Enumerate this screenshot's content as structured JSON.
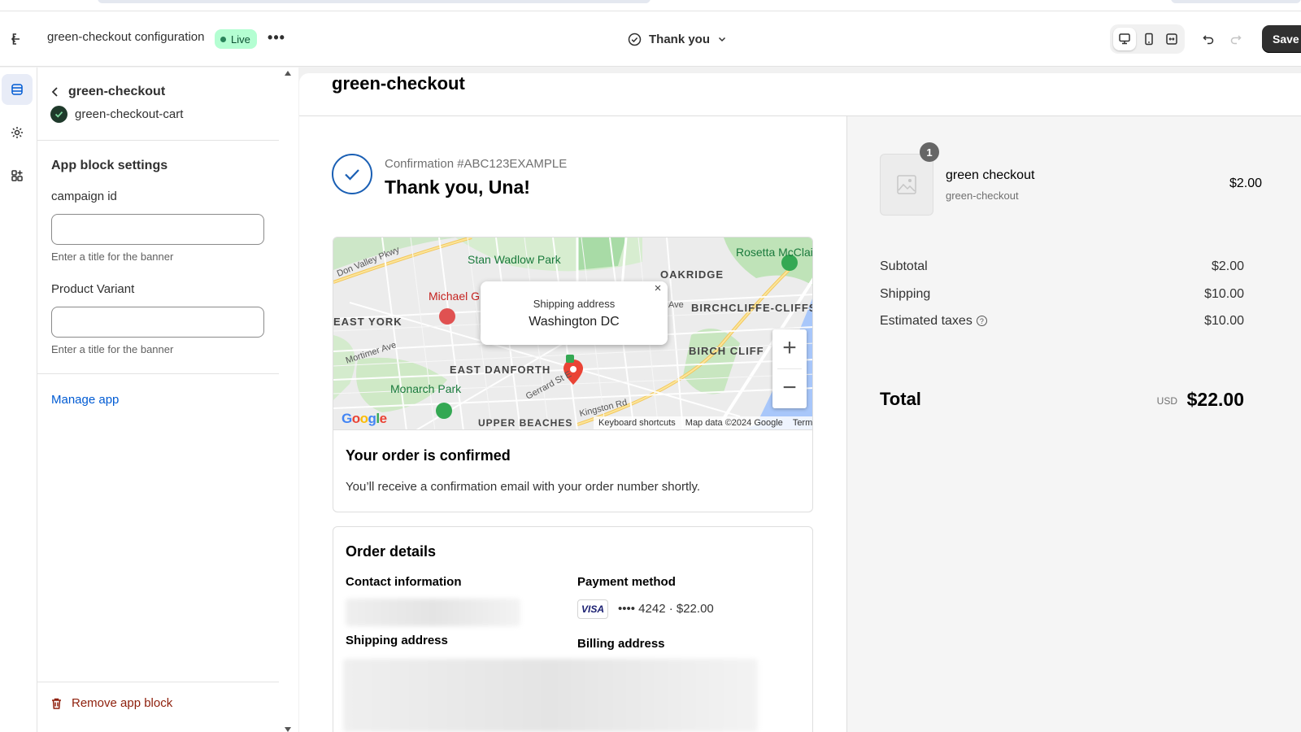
{
  "header": {
    "title": "green-checkout configuration",
    "status": "Live",
    "page_selector": "Thank you",
    "save_label": "Save"
  },
  "panel": {
    "back_title": "green-checkout",
    "app_name": "green-checkout-cart",
    "section_title": "App block settings",
    "fields": [
      {
        "label": "campaign id",
        "value": "",
        "help": "Enter a title for the banner"
      },
      {
        "label": "Product Variant",
        "value": "",
        "help": "Enter a title for the banner"
      }
    ],
    "manage_link": "Manage app",
    "remove_label": "Remove app block"
  },
  "preview": {
    "shop_name": "green-checkout",
    "confirmation_number": "Confirmation #ABC123EXAMPLE",
    "thank_you": "Thank you, Una!",
    "map": {
      "popup_title": "Shipping address",
      "popup_value": "Washington DC",
      "popup_close": "×",
      "zoom_in": "+",
      "zoom_out": "−",
      "logo": "Google",
      "attribution": [
        "Keyboard shortcuts",
        "Map data ©2024 Google",
        "Terms"
      ],
      "neighborhoods": [
        "OAKRIDGE",
        "BIRCHCLIFFE-CLIFFSI",
        "EAST YORK",
        "BIRCH CLIFF",
        "EAST DANFORTH",
        "UPPER BEACHES"
      ],
      "parks": [
        "Stan Wadlow Park",
        "Rosetta McClain Gardens",
        "Monarch Park",
        "Michael G"
      ],
      "streets": [
        "Don Valley Pkwy",
        "Mortimer Ave",
        "Gerrard St E",
        "Kingston Rd",
        "Ave"
      ]
    },
    "confirmed_title": "Your order is confirmed",
    "confirmed_text": "You’ll receive a confirmation email with your order number shortly.",
    "order_details_title": "Order details",
    "contact_label": "Contact information",
    "payment_label": "Payment method",
    "card_brand": "VISA",
    "payment_text": "•••• 4242 · $22.00",
    "shipping_label": "Shipping address",
    "billing_label": "Billing address"
  },
  "summary": {
    "item": {
      "quantity": "1",
      "name": "green checkout",
      "variant": "green-checkout",
      "price": "$2.00"
    },
    "subtotal_label": "Subtotal",
    "subtotal": "$2.00",
    "shipping_label": "Shipping",
    "shipping": "$10.00",
    "taxes_label": "Estimated taxes",
    "taxes": "$10.00",
    "total_label": "Total",
    "currency": "USD",
    "total": "$22.00"
  },
  "colors": {
    "accent": "#1a5fb4",
    "live_badge_bg": "#b4fed2",
    "link": "#005bd3",
    "danger": "#8e1f0b",
    "save_button": "#303030"
  }
}
